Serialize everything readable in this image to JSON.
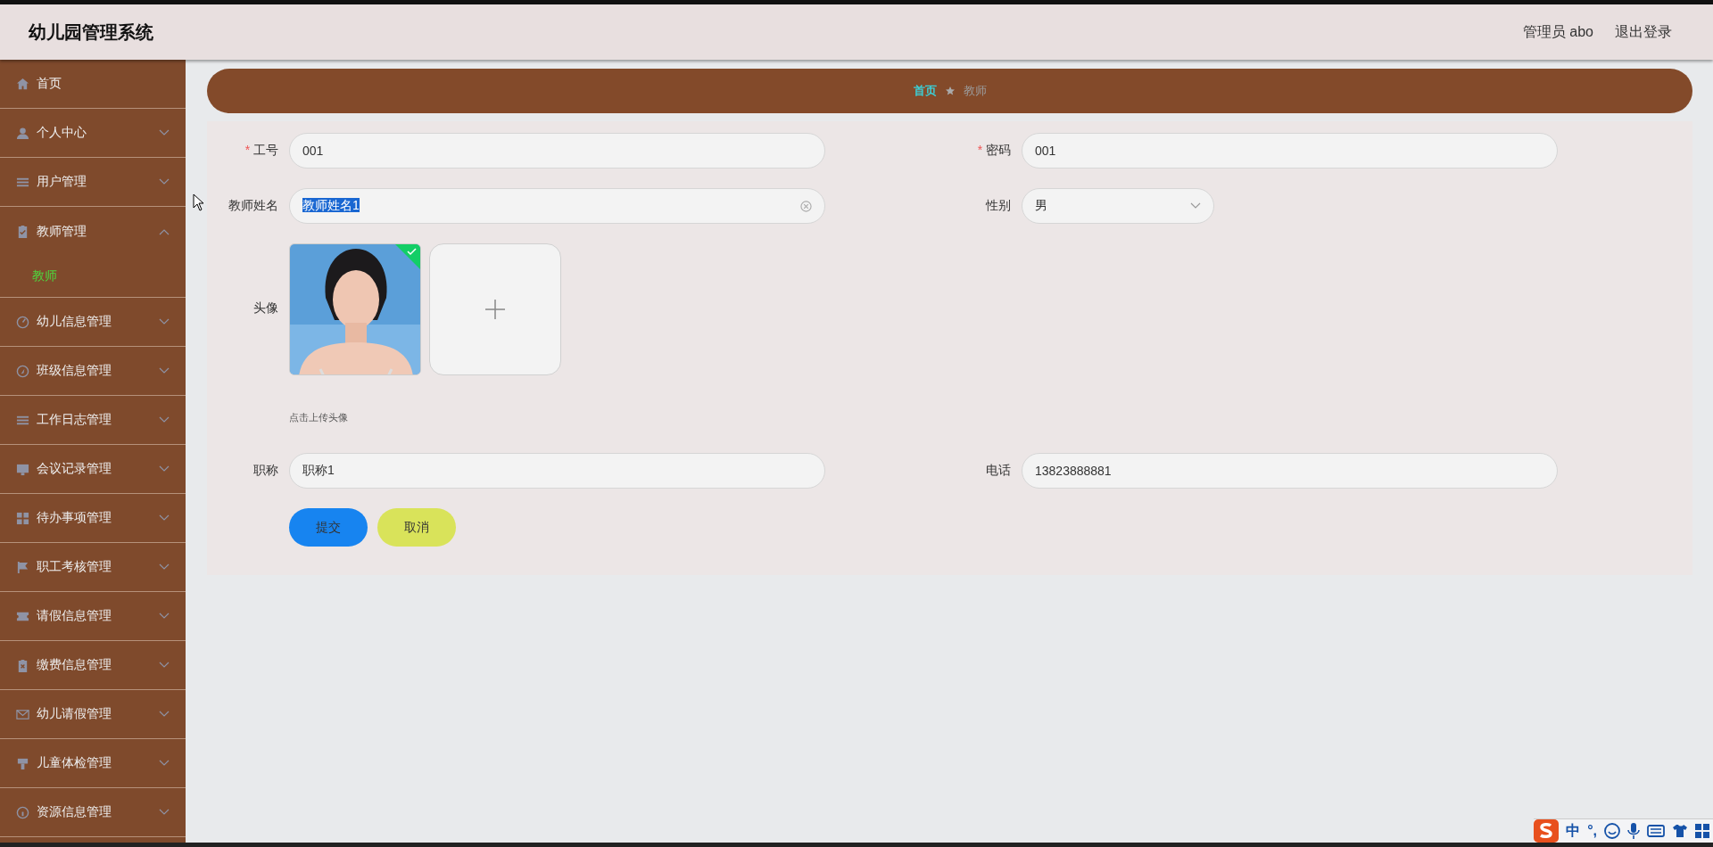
{
  "header": {
    "title": "幼儿园管理系统",
    "user": "管理员 abo",
    "logout": "退出登录"
  },
  "sidebar": {
    "items": [
      {
        "label": "首页",
        "kind": "link"
      },
      {
        "label": "个人中心",
        "kind": "menu",
        "expanded": false
      },
      {
        "label": "用户管理",
        "kind": "menu",
        "expanded": false
      },
      {
        "label": "教师管理",
        "kind": "menu",
        "expanded": true,
        "children": [
          {
            "label": "教师",
            "selected": true
          }
        ]
      },
      {
        "label": "幼儿信息管理",
        "kind": "menu",
        "expanded": false
      },
      {
        "label": "班级信息管理",
        "kind": "menu",
        "expanded": false
      },
      {
        "label": "工作日志管理",
        "kind": "menu",
        "expanded": false
      },
      {
        "label": "会议记录管理",
        "kind": "menu",
        "expanded": false
      },
      {
        "label": "待办事项管理",
        "kind": "menu",
        "expanded": false
      },
      {
        "label": "职工考核管理",
        "kind": "menu",
        "expanded": false
      },
      {
        "label": "请假信息管理",
        "kind": "menu",
        "expanded": false
      },
      {
        "label": "缴费信息管理",
        "kind": "menu",
        "expanded": false
      },
      {
        "label": "幼儿请假管理",
        "kind": "menu",
        "expanded": false
      },
      {
        "label": "儿童体检管理",
        "kind": "menu",
        "expanded": false
      },
      {
        "label": "资源信息管理",
        "kind": "menu",
        "expanded": false
      }
    ]
  },
  "breadcrumb": [
    {
      "label": "首页",
      "current": false
    },
    {
      "label": "教师",
      "current": true
    }
  ],
  "form": {
    "required_mark": "*",
    "fields": [
      {
        "kind": "text",
        "label": "工号",
        "required": true,
        "value": "001"
      },
      {
        "kind": "text",
        "label": "密码",
        "required": true,
        "value": "001"
      },
      {
        "kind": "text",
        "label": "教师姓名",
        "required": false,
        "value": "教师姓名1",
        "highlighted": true,
        "clearable": true
      },
      {
        "kind": "select",
        "label": "性别",
        "required": false,
        "value": "男"
      },
      {
        "kind": "upload",
        "label": "头像",
        "required": false,
        "uploaded": true,
        "hint": "点击上传头像"
      },
      {
        "kind": "text",
        "label": "职称",
        "required": false,
        "value": "职称1"
      },
      {
        "kind": "text",
        "label": "电话",
        "required": false,
        "value": "13823888881"
      }
    ],
    "buttons": [
      {
        "label": "提交",
        "kind": "primary"
      },
      {
        "label": "取消",
        "kind": "secondary"
      }
    ]
  },
  "ime_bar": {
    "mode": "中",
    "punctuation": "°,"
  }
}
